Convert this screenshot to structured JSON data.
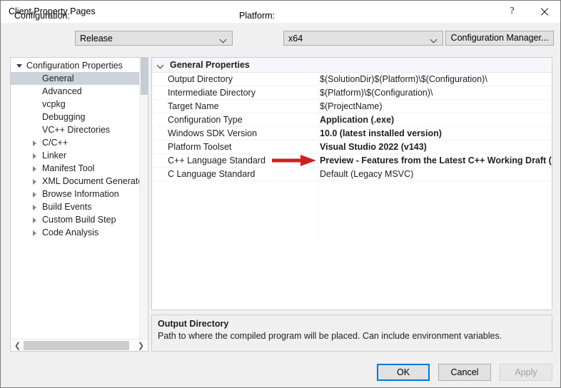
{
  "window": {
    "title": "Client Property Pages",
    "help_icon": "question-mark-icon",
    "close_icon": "close-icon"
  },
  "configbar": {
    "configuration_label": "Configuration:",
    "configuration_value": "Release",
    "platform_label": "Platform:",
    "platform_value": "x64",
    "configuration_manager_button": "Configuration Manager..."
  },
  "tree": {
    "items": [
      {
        "label": "Configuration Properties",
        "indent": 0,
        "twisty": "expanded",
        "selected": false
      },
      {
        "label": "General",
        "indent": 1,
        "twisty": "none",
        "selected": true
      },
      {
        "label": "Advanced",
        "indent": 1,
        "twisty": "none",
        "selected": false
      },
      {
        "label": "vcpkg",
        "indent": 1,
        "twisty": "none",
        "selected": false
      },
      {
        "label": "Debugging",
        "indent": 1,
        "twisty": "none",
        "selected": false
      },
      {
        "label": "VC++ Directories",
        "indent": 1,
        "twisty": "none",
        "selected": false
      },
      {
        "label": "C/C++",
        "indent": 1,
        "twisty": "collapsed",
        "selected": false
      },
      {
        "label": "Linker",
        "indent": 1,
        "twisty": "collapsed",
        "selected": false
      },
      {
        "label": "Manifest Tool",
        "indent": 1,
        "twisty": "collapsed",
        "selected": false
      },
      {
        "label": "XML Document Generator",
        "indent": 1,
        "twisty": "collapsed",
        "selected": false
      },
      {
        "label": "Browse Information",
        "indent": 1,
        "twisty": "collapsed",
        "selected": false
      },
      {
        "label": "Build Events",
        "indent": 1,
        "twisty": "collapsed",
        "selected": false
      },
      {
        "label": "Custom Build Step",
        "indent": 1,
        "twisty": "collapsed",
        "selected": false
      },
      {
        "label": "Code Analysis",
        "indent": 1,
        "twisty": "collapsed",
        "selected": false
      }
    ],
    "scroll_left_arrow": "❮",
    "scroll_right_arrow": "❯"
  },
  "grid": {
    "section_title": "General Properties",
    "section_state": "expanded",
    "rows": [
      {
        "name": "Output Directory",
        "value": "$(SolutionDir)$(Platform)\\$(Configuration)\\",
        "bold": false
      },
      {
        "name": "Intermediate Directory",
        "value": "$(Platform)\\$(Configuration)\\",
        "bold": false
      },
      {
        "name": "Target Name",
        "value": "$(ProjectName)",
        "bold": false
      },
      {
        "name": "Configuration Type",
        "value": "Application (.exe)",
        "bold": true
      },
      {
        "name": "Windows SDK Version",
        "value": "10.0 (latest installed version)",
        "bold": true
      },
      {
        "name": "Platform Toolset",
        "value": "Visual Studio 2022 (v143)",
        "bold": true
      },
      {
        "name": "C++ Language Standard",
        "value": "Preview - Features from the Latest C++ Working Draft (/std:c++latest)",
        "bold": true
      },
      {
        "name": "C Language Standard",
        "value": "Default (Legacy MSVC)",
        "bold": false
      }
    ]
  },
  "annotation": {
    "arrow_color": "#cc2222",
    "points_to_row": "C++ Language Standard"
  },
  "description": {
    "title": "Output Directory",
    "text": "Path to where the compiled program will be placed. Can include environment variables."
  },
  "buttons": {
    "ok": "OK",
    "cancel": "Cancel",
    "apply": "Apply"
  },
  "colors": {
    "focus_border": "#0078d7",
    "selection": "#cdd2dc",
    "dialog_bg": "#f0f0f0"
  }
}
